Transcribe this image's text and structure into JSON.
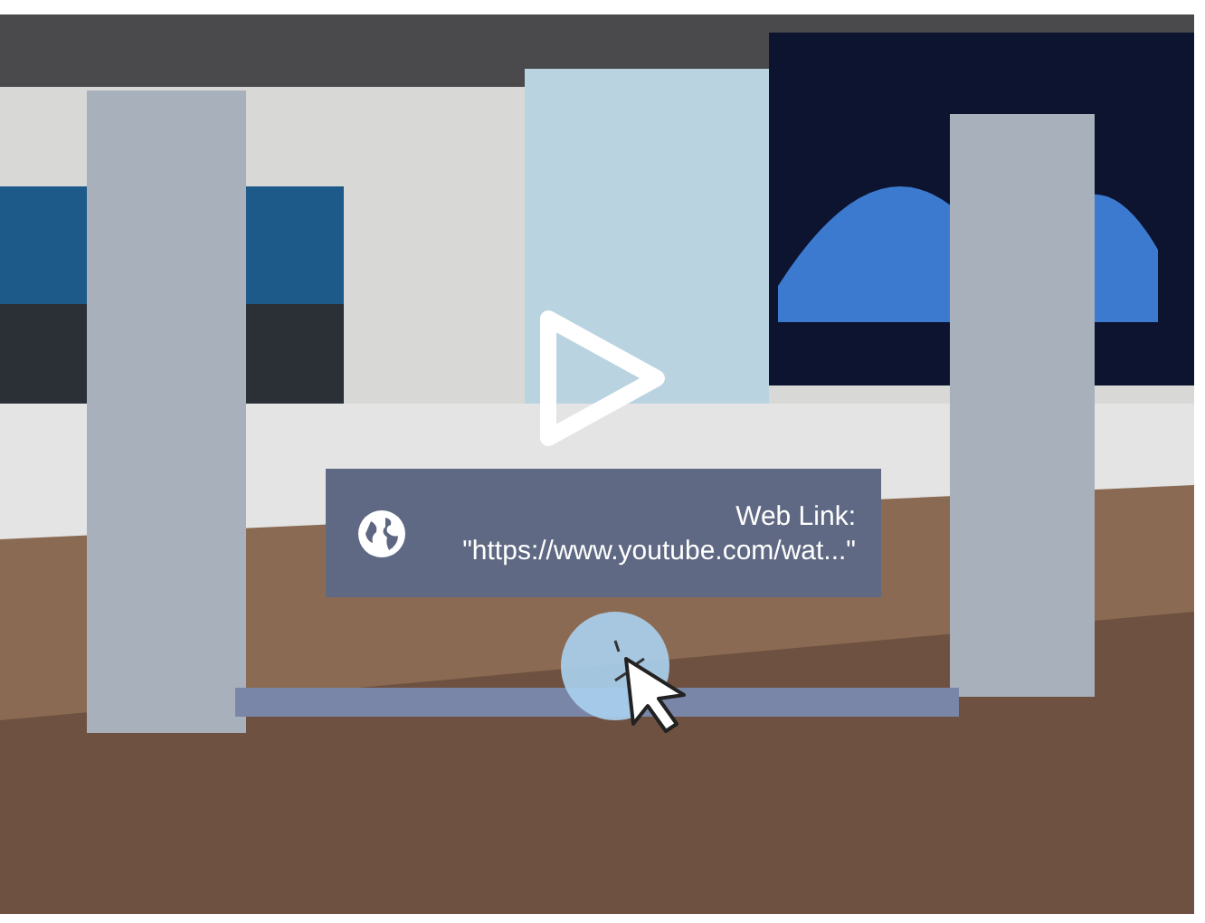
{
  "link_card": {
    "label": "Web Link:",
    "url": "\"https://www.youtube.com/wat...\""
  }
}
